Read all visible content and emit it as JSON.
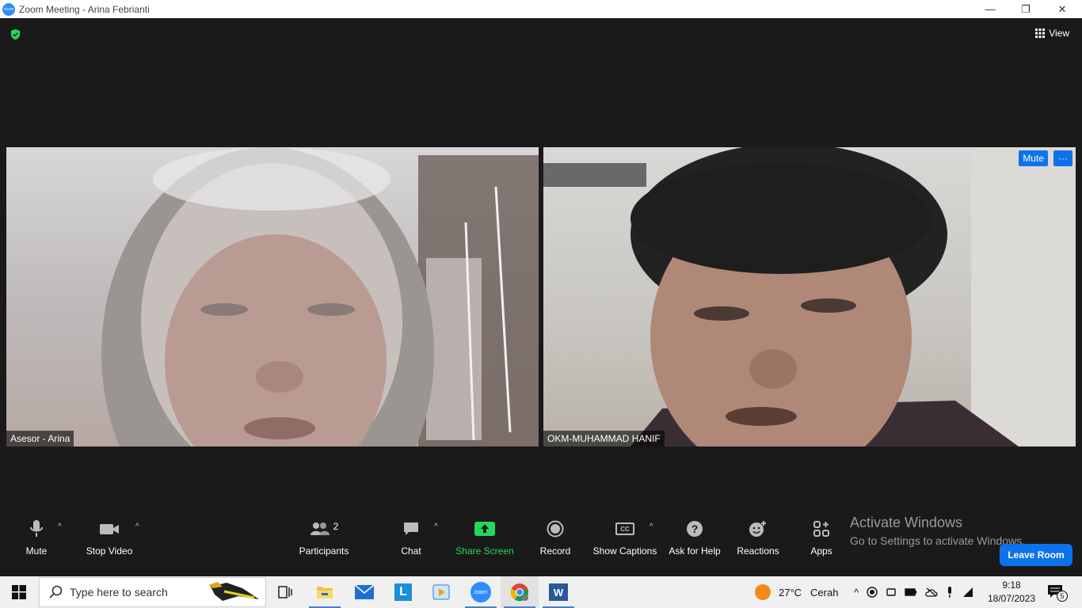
{
  "window": {
    "title": "Zoom Meeting - Arina Febrianti",
    "app_logo_text": "zoom",
    "controls": {
      "minimize": "—",
      "restore": "❐",
      "close": "✕"
    }
  },
  "top": {
    "view_label": "View"
  },
  "participants": [
    {
      "name": "Asesor - Arina"
    },
    {
      "name": "OKM-MUHAMMAD HANIF",
      "mute_label": "Mute",
      "more_label": "···"
    }
  ],
  "toolbar": {
    "mute": "Mute",
    "stop_video": "Stop Video",
    "participants": "Participants",
    "participants_count": "2",
    "chat": "Chat",
    "share_screen": "Share Screen",
    "record": "Record",
    "show_captions": "Show Captions",
    "ask_for_help": "Ask for Help",
    "reactions": "Reactions",
    "apps": "Apps",
    "leave": "Leave Room",
    "captions_icon_text": "CC"
  },
  "watermark": {
    "line1": "Activate Windows",
    "line2": "Go to Settings to activate Windows."
  },
  "taskbar": {
    "search_placeholder": "Type here to search",
    "weather_temp": "27°C",
    "weather_desc": "Cerah",
    "time": "9:18",
    "date": "18/07/2023",
    "notification_count": "5",
    "zoom_icon_text": "zoom",
    "l_app_letter": "L",
    "word_letter": "W"
  },
  "colors": {
    "accent": "#0e72ed",
    "share_green": "#23d959",
    "meeting_bg": "#1a1a1a"
  }
}
